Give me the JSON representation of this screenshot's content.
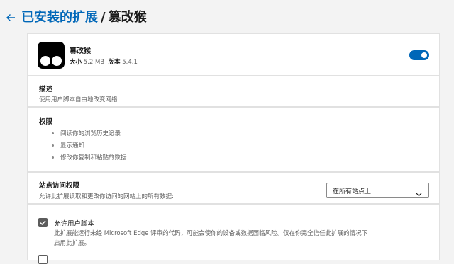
{
  "breadcrumb": {
    "parent": "已安装的扩展",
    "separator": "/",
    "current": "篡改猴"
  },
  "extension": {
    "name": "篡改猴",
    "size_label": "大小",
    "size_value": "5.2 MB",
    "version_label": "版本",
    "version_value": "5.4.1",
    "enabled": true,
    "icon": "tampermonkey-logo-icon"
  },
  "description": {
    "title": "描述",
    "text": "使用用户脚本自由地改变网络"
  },
  "permissions": {
    "title": "权限",
    "items": [
      "阅读你的浏览历史记录",
      "显示通知",
      "修改你复制和粘贴的数据"
    ]
  },
  "site_access": {
    "title": "站点访问权限",
    "text": "允许此扩展读取和更改你访问的网站上的所有数据:",
    "selected": "在所有站点上"
  },
  "options": {
    "user_scripts_label": "允许用户脚本",
    "user_scripts_checked": true,
    "user_scripts_desc_line1": "此扩展能运行未经 Microsoft Edge 评审的代码，可能会使你的设备或数据面临风险。仅在你完全信任此扩展的情况下",
    "user_scripts_desc_line2": "启用此扩展。",
    "second_checked": false
  },
  "colors": {
    "accent": "#0067b8",
    "background": "#f3f3f3",
    "card": "#ffffff"
  }
}
